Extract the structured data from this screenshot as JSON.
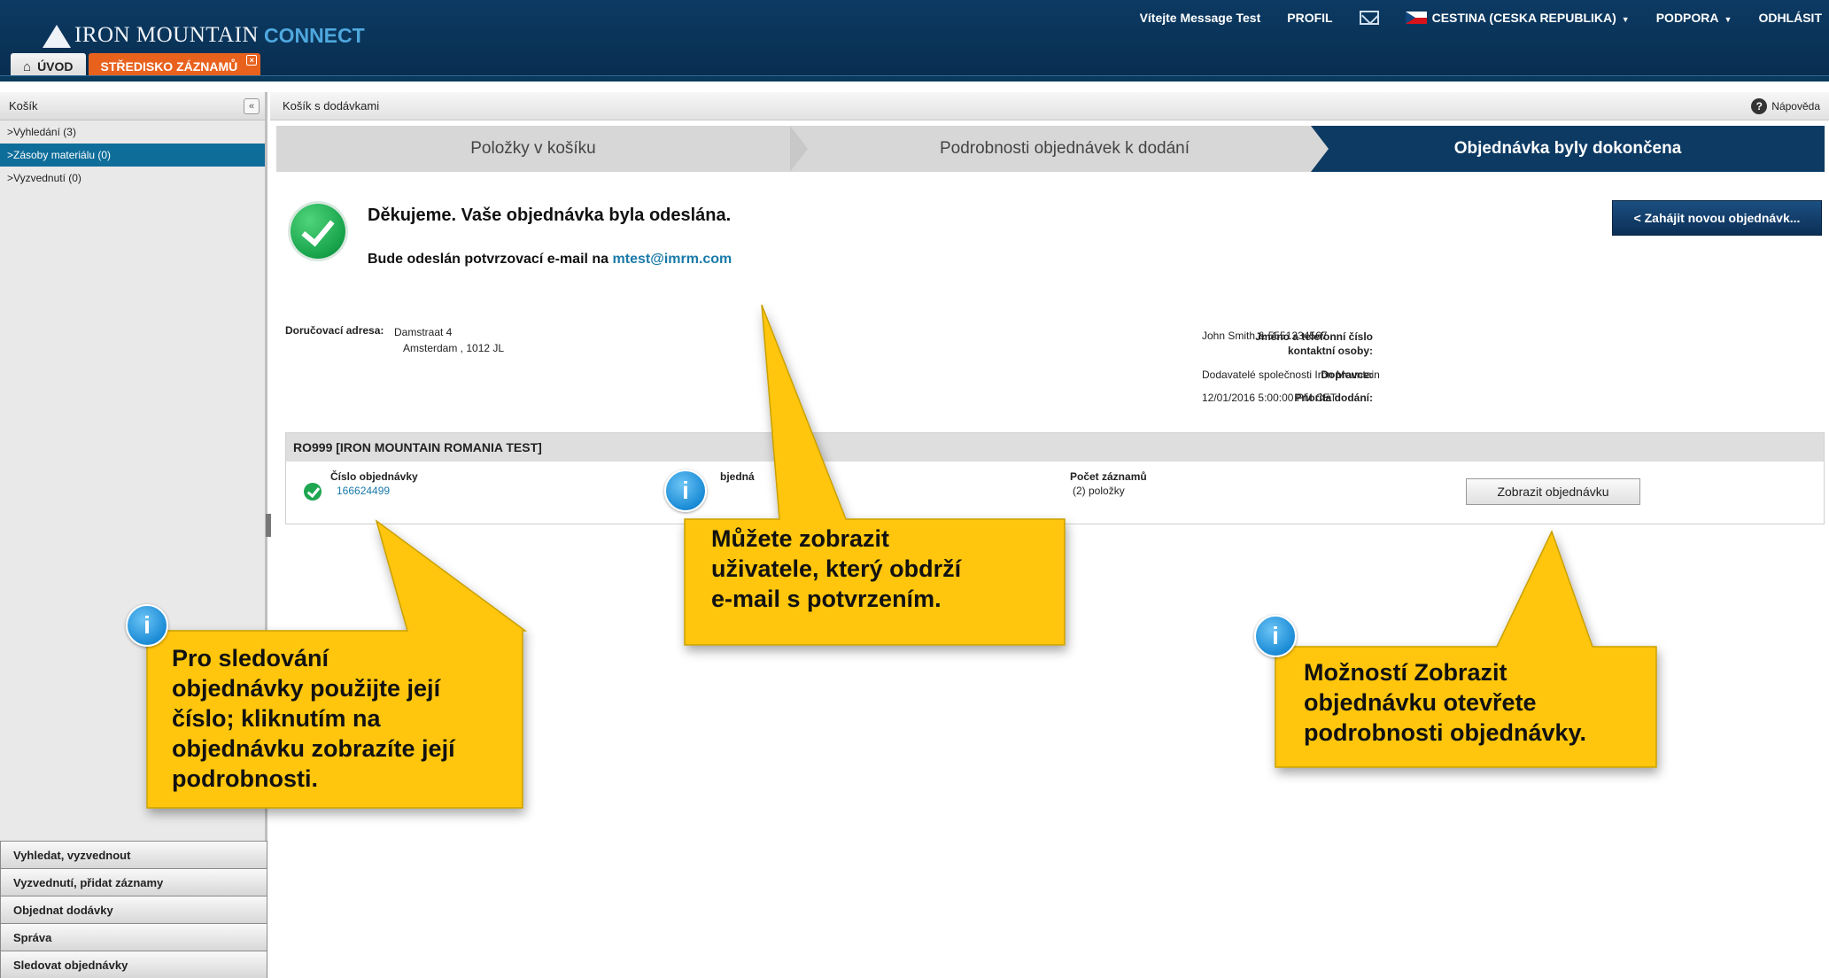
{
  "header": {
    "logo_text": "IRON MOUNTAIN",
    "logo_connect": "CONNECT",
    "welcome": "Vítejte Message Test",
    "profile": "PROFIL",
    "language": "CESTINA (CESKA REPUBLIKA)",
    "support": "PODPORA",
    "logout": "ODHLÁSIT",
    "tabs": [
      "ÚVOD",
      "STŘEDISKO ZÁZNAMŮ"
    ]
  },
  "sidebar": {
    "title": "Košík",
    "items": [
      {
        "label": ">Vyhledání (3)",
        "active": false
      },
      {
        "label": ">Zásoby materiálu (0)",
        "active": true
      },
      {
        "label": ">Vyzvednutí (0)",
        "active": false
      }
    ],
    "menu": [
      "Vyhledat, vyzvednout",
      "Vyzvednutí, přidat záznamy",
      "Objednat dodávky",
      "Správa",
      "Sledovat objednávky"
    ]
  },
  "main": {
    "title": "Košík s dodávkami",
    "help": "Nápověda",
    "steps": [
      "Položky v košíku",
      "Podrobnosti objednávek k dodání",
      "Objednávka byly dokončena"
    ],
    "thanks_title": "Děkujeme. Vaše objednávka byla odeslána.",
    "thanks_sub": "Bude odeslán potvrzovací e-mail na",
    "email": "mtest@imrm.com",
    "new_order_button": "< Zahájit novou objednávk...",
    "delivery_address_label": "Doručovací adresa:",
    "delivery_address_line1": "Damstraat 4",
    "delivery_address_line2": "Amsterdam , 1012 JL",
    "contact_label": "Jméno a telefonní číslo kontaktní osoby:",
    "contact_label_1": "Jméno a telefonní číslo",
    "contact_label_2": "kontaktní osoby:",
    "contact_value": "John Smith & 5551234567",
    "carrier_label": "Dopravce:",
    "carrier_value": "Dodavatelé společnosti Iron Mountain",
    "priority_label": "Priorita dodání:",
    "priority_value": "12/01/2016 5:00:00 PM CET",
    "order_box_title": "RO999 [IRON MOUNTAIN ROMANIA TEST]",
    "order_number_label": "Číslo objednávky",
    "order_number": "166624499",
    "orderer_label_partial": "bjedná",
    "record_count_label": "Počet záznamů",
    "record_count_value": "(2) položky",
    "view_order_button": "Zobrazit objednávku"
  },
  "callouts": [
    {
      "text": "Pro sledování objednávky použijte její číslo; kliknutím na objednávku zobrazíte její podrobnosti.",
      "lines": [
        "Pro sledování",
        "objednávky použijte její",
        "číslo; kliknutím na",
        "objednávku zobrazíte její",
        "podrobnosti."
      ]
    },
    {
      "text": "Můžete zobrazit uživatele, který obdrží e-mail s potvrzením.",
      "lines": [
        "Můžete zobrazit",
        "uživatele, který obdrží",
        "e-mail s potvrzením."
      ]
    },
    {
      "text": "Možností Zobrazit objednávku otevřete podrobnosti objednávky.",
      "lines": [
        "Možností Zobrazit",
        "objednávku otevřete",
        "podrobnosti objednávky."
      ]
    }
  ],
  "info_badge_glyph": "i",
  "colors": {
    "header_bg": "#0c3a63",
    "tab_active": "#e8621e",
    "sidebar_active": "#0f6d9a",
    "link": "#1a7aa8",
    "callout_fill": "#ffc60a",
    "success": "#1ea651",
    "info_badge": "#1a8bd6"
  }
}
